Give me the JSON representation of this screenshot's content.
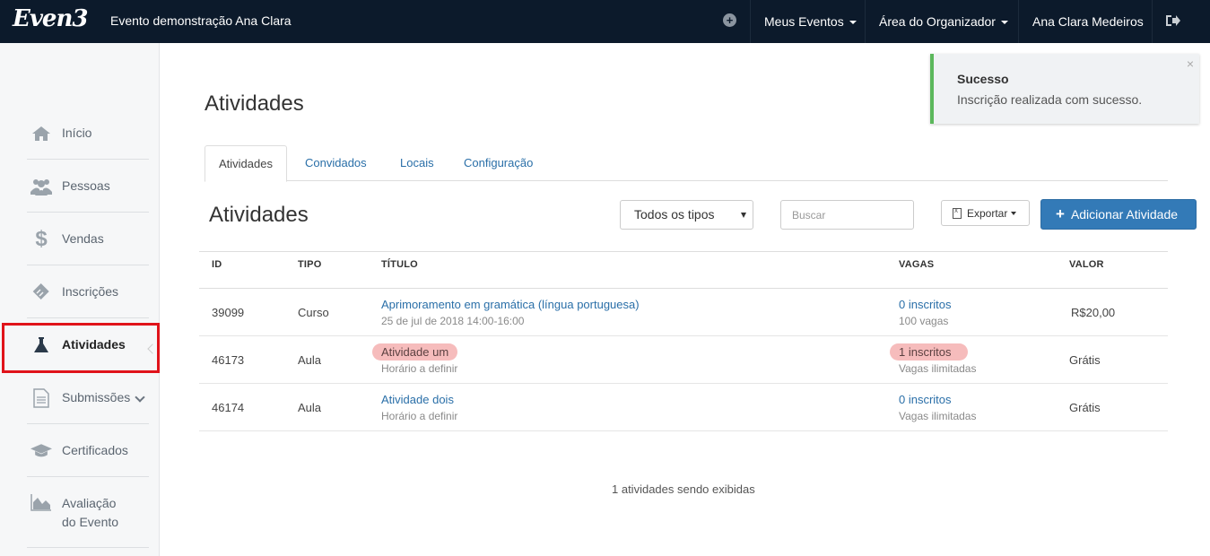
{
  "topbar": {
    "logo": "Even3",
    "event_title": "Evento demonstração Ana Clara",
    "nav": [
      {
        "label": "Meus Eventos"
      },
      {
        "label": "Área do Organizador"
      },
      {
        "label": "Ana Clara Medeiros"
      }
    ]
  },
  "sidebar": {
    "items": [
      {
        "label": "Início",
        "icon": "home-icon"
      },
      {
        "label": "Pessoas",
        "icon": "users-icon"
      },
      {
        "label": "Vendas",
        "icon": "dollar-icon"
      },
      {
        "label": "Inscrições",
        "icon": "ticket-icon"
      },
      {
        "label": "Atividades",
        "icon": "flask-icon"
      },
      {
        "label": "Submissões",
        "icon": "document-icon"
      },
      {
        "label": "Certificados",
        "icon": "graduation-cap-icon"
      },
      {
        "label": "Avaliação do Evento",
        "line1": "Avaliação",
        "line2": "do Evento",
        "icon": "area-chart-icon"
      }
    ],
    "active": "Atividades"
  },
  "main": {
    "page_title": "Atividades",
    "tabs": [
      {
        "label": "Atividades"
      },
      {
        "label": "Convidados"
      },
      {
        "label": "Locais"
      },
      {
        "label": "Configuração"
      }
    ],
    "section_title": "Atividades",
    "filter_select": "Todos os tipos",
    "search_placeholder": "Buscar",
    "export_label": "Exportar",
    "add_label": "Adicionar Atividade"
  },
  "table": {
    "headers": [
      "ID",
      "TIPO",
      "TÍTULO",
      "VAGAS",
      "VALOR"
    ],
    "rows": [
      {
        "id": "39099",
        "tipo": "Curso",
        "titulo": "Aprimoramento em gramática (língua portuguesa)",
        "subtitulo": "25 de jul de 2018 14:00-16:00",
        "inscritos": "0 inscritos",
        "vagas": "100 vagas",
        "valor": "R$20,00"
      },
      {
        "id": "46173",
        "tipo": "Aula",
        "titulo": "Atividade um",
        "subtitulo": "Horário a definir",
        "inscritos": "1 inscritos",
        "vagas": "Vagas ilimitadas",
        "valor": "Grátis"
      },
      {
        "id": "46174",
        "tipo": "Aula",
        "titulo": "Atividade dois",
        "subtitulo": "Horário a definir",
        "inscritos": "0 inscritos",
        "vagas": "Vagas ilimitadas",
        "valor": "Grátis"
      }
    ],
    "footer": "1 atividades sendo exibidas"
  },
  "toast": {
    "title": "Sucesso",
    "message": "Inscrição realizada com sucesso.",
    "close": "×",
    "accent_color": "#5cb85c"
  },
  "colors": {
    "topbar_bg": "#0c1a2b",
    "primary": "#337ab7",
    "link": "#2a6fa8",
    "highlight": "#f6bcbc",
    "active_outline": "#e0131a"
  }
}
